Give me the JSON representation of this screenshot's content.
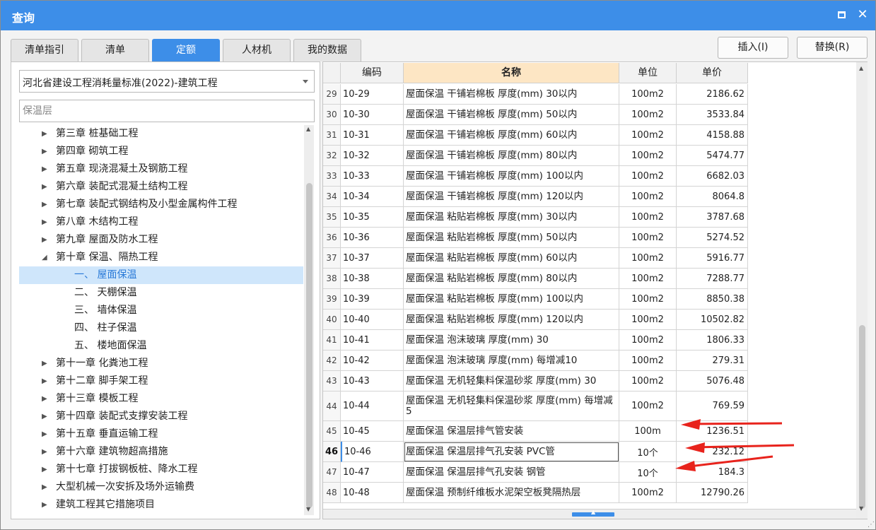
{
  "window": {
    "title": "查询"
  },
  "tabs": [
    {
      "label": "清单指引",
      "active": false
    },
    {
      "label": "清单",
      "active": false
    },
    {
      "label": "定额",
      "active": true
    },
    {
      "label": "人材机",
      "active": false
    },
    {
      "label": "我的数据",
      "active": false
    }
  ],
  "actions": {
    "insert": "插入(I)",
    "replace": "替换(R)"
  },
  "left": {
    "library_select": "河北省建设工程消耗量标准(2022)-建筑工程",
    "search_placeholder": "保温层",
    "tree": [
      {
        "label": "第三章 桩基础工程",
        "expander": "collapsed"
      },
      {
        "label": "第四章 砌筑工程",
        "expander": "collapsed"
      },
      {
        "label": "第五章 现浇混凝土及钢筋工程",
        "expander": "collapsed"
      },
      {
        "label": "第六章 装配式混凝土结构工程",
        "expander": "collapsed"
      },
      {
        "label": "第七章 装配式钢结构及小型金属构件工程",
        "expander": "collapsed"
      },
      {
        "label": "第八章 木结构工程",
        "expander": "collapsed"
      },
      {
        "label": "第九章 屋面及防水工程",
        "expander": "collapsed"
      },
      {
        "label": "第十章 保温、隔热工程",
        "expander": "expanded"
      },
      {
        "label": "一、 屋面保温",
        "expander": "none",
        "selected": true
      },
      {
        "label": "二、 天棚保温",
        "expander": "none"
      },
      {
        "label": "三、 墙体保温",
        "expander": "none"
      },
      {
        "label": "四、 柱子保温",
        "expander": "none"
      },
      {
        "label": "五、 楼地面保温",
        "expander": "none"
      },
      {
        "label": "第十一章 化粪池工程",
        "expander": "collapsed"
      },
      {
        "label": "第十二章 脚手架工程",
        "expander": "collapsed"
      },
      {
        "label": "第十三章 模板工程",
        "expander": "collapsed"
      },
      {
        "label": "第十四章 装配式支撑安装工程",
        "expander": "collapsed"
      },
      {
        "label": "第十五章 垂直运输工程",
        "expander": "collapsed"
      },
      {
        "label": "第十六章 建筑物超高措施",
        "expander": "collapsed"
      },
      {
        "label": "第十七章 打拔钢板桩、降水工程",
        "expander": "collapsed"
      },
      {
        "label": "大型机械一次安拆及场外运输费",
        "expander": "collapsed"
      },
      {
        "label": "建筑工程其它措施项目",
        "expander": "collapsed"
      }
    ]
  },
  "table": {
    "columns": {
      "code": "编码",
      "name": "名称",
      "unit": "单位",
      "price": "单价"
    },
    "rows": [
      {
        "idx": "29",
        "code": "10-29",
        "name": "屋面保温 干铺岩棉板 厚度(mm) 30以内",
        "unit": "100m2",
        "price": "2186.62"
      },
      {
        "idx": "30",
        "code": "10-30",
        "name": "屋面保温 干铺岩棉板 厚度(mm) 50以内",
        "unit": "100m2",
        "price": "3533.84"
      },
      {
        "idx": "31",
        "code": "10-31",
        "name": "屋面保温 干铺岩棉板 厚度(mm) 60以内",
        "unit": "100m2",
        "price": "4158.88"
      },
      {
        "idx": "32",
        "code": "10-32",
        "name": "屋面保温 干铺岩棉板 厚度(mm) 80以内",
        "unit": "100m2",
        "price": "5474.77"
      },
      {
        "idx": "33",
        "code": "10-33",
        "name": "屋面保温 干铺岩棉板 厚度(mm) 100以内",
        "unit": "100m2",
        "price": "6682.03"
      },
      {
        "idx": "34",
        "code": "10-34",
        "name": "屋面保温 干铺岩棉板 厚度(mm) 120以内",
        "unit": "100m2",
        "price": "8064.8"
      },
      {
        "idx": "35",
        "code": "10-35",
        "name": "屋面保温 粘贴岩棉板 厚度(mm) 30以内",
        "unit": "100m2",
        "price": "3787.68"
      },
      {
        "idx": "36",
        "code": "10-36",
        "name": "屋面保温 粘贴岩棉板 厚度(mm) 50以内",
        "unit": "100m2",
        "price": "5274.52"
      },
      {
        "idx": "37",
        "code": "10-37",
        "name": "屋面保温 粘贴岩棉板 厚度(mm) 60以内",
        "unit": "100m2",
        "price": "5916.77"
      },
      {
        "idx": "38",
        "code": "10-38",
        "name": "屋面保温 粘贴岩棉板 厚度(mm) 80以内",
        "unit": "100m2",
        "price": "7288.77"
      },
      {
        "idx": "39",
        "code": "10-39",
        "name": "屋面保温 粘贴岩棉板 厚度(mm) 100以内",
        "unit": "100m2",
        "price": "8850.38"
      },
      {
        "idx": "40",
        "code": "10-40",
        "name": "屋面保温 粘贴岩棉板 厚度(mm) 120以内",
        "unit": "100m2",
        "price": "10502.82"
      },
      {
        "idx": "41",
        "code": "10-41",
        "name": "屋面保温 泡沫玻璃 厚度(mm) 30",
        "unit": "100m2",
        "price": "1806.33"
      },
      {
        "idx": "42",
        "code": "10-42",
        "name": "屋面保温 泡沫玻璃 厚度(mm) 每增减10",
        "unit": "100m2",
        "price": "279.31"
      },
      {
        "idx": "43",
        "code": "10-43",
        "name": "屋面保温 无机轻集料保温砂浆 厚度(mm) 30",
        "unit": "100m2",
        "price": "5076.48"
      },
      {
        "idx": "44",
        "code": "10-44",
        "name": "屋面保温 无机轻集料保温砂浆 厚度(mm) 每增减5",
        "unit": "100m2",
        "price": "769.59"
      },
      {
        "idx": "45",
        "code": "10-45",
        "name": "屋面保温 保温层排气管安装",
        "unit": "100m",
        "price": "1236.51"
      },
      {
        "idx": "46",
        "code": "10-46",
        "name": "屋面保温 保温层排气孔安装 PVC管",
        "unit": "10个",
        "price": "232.12",
        "active": true
      },
      {
        "idx": "47",
        "code": "10-47",
        "name": "屋面保温 保温层排气孔安装 钢管",
        "unit": "10个",
        "price": "184.3"
      },
      {
        "idx": "48",
        "code": "10-48",
        "name": "屋面保温 预制纤维板水泥架空板凳隔热层",
        "unit": "100m2",
        "price": "12790.26"
      }
    ]
  },
  "icons": {
    "maximize": "maximize-icon",
    "close": "close-icon",
    "dropdown": "chevron-down-icon",
    "tree_collapsed": "triangle-right-icon",
    "tree_expanded": "triangle-down-icon",
    "annotation": "red-arrow-icon"
  },
  "colors": {
    "titlebar": "#3d8ee8",
    "active_tab": "#3d8ee8",
    "name_header": "#fde6c4",
    "selected_tree_item": "#cfe6fb",
    "annotation_arrow": "#e8231c"
  }
}
